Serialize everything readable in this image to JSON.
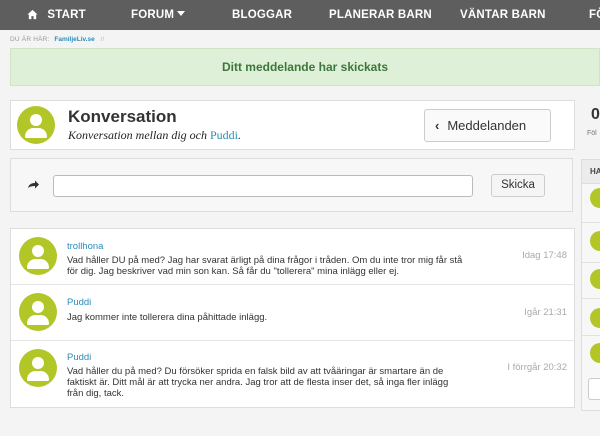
{
  "nav": {
    "start": "START",
    "forum": "FORUM",
    "bloggar": "BLOGGAR",
    "planerar": "PLANERAR BARN",
    "vantar": "VÄNTAR BARN",
    "fo": "FÖ"
  },
  "breadcrumb": {
    "label": "DU ÄR HÄR:",
    "link": "FamiljeLiv.se",
    "separator": "//"
  },
  "banner": {
    "text": "Ditt meddelande har skickats"
  },
  "conversation": {
    "title": "Konversation",
    "subtitle_prefix": "Konversation mellan dig och ",
    "subtitle_link": "Puddi",
    "subtitle_suffix": ".",
    "messages_button": "Meddelanden",
    "right_number": "0",
    "right_label": "Föl"
  },
  "right_panel": {
    "header": "HA"
  },
  "reply": {
    "input_value": "",
    "send_label": "Skicka"
  },
  "messages": [
    {
      "author": "trollhona",
      "text": "Vad håller DU på med? Jag har svarat ärligt på dina frågor i tråden. Om du inte tror mig får stå för dig. Jag beskriver vad min son kan. Så får du \"tollerera\" mina inlägg eller ej.",
      "time": "Idag 17:48"
    },
    {
      "author": "Puddi",
      "text": "Jag kommer inte tollerera dina påhittade inlägg.",
      "time": "Igår 21:31"
    },
    {
      "author": "Puddi",
      "text": "Vad håller du på med? Du försöker sprida en falsk bild av att tvåäringar är smartare än de faktiskt är. Ditt mål är att trycka ner andra. Jag tror att de flesta inser det, så inga fler inlägg från dig, tack.",
      "time": "I förrgår 20:32"
    }
  ],
  "colors": {
    "nav_bg": "#5e5e5e",
    "avatar": "#b3c628",
    "link": "#2a8db8",
    "success_bg": "#dff0d8",
    "success_text": "#3c763d"
  },
  "icons": {
    "home": "home-icon",
    "reply": "reply-arrow-icon",
    "back": "chevron-left-icon",
    "user": "user-avatar-icon"
  }
}
